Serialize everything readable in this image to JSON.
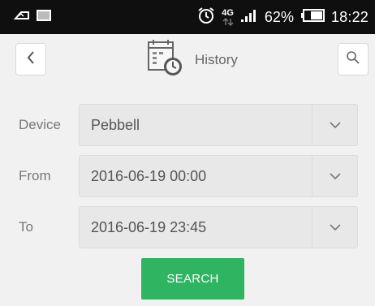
{
  "status_bar": {
    "network": "4G",
    "battery_percent": "62%",
    "time": "18:22"
  },
  "header": {
    "title": "History"
  },
  "form": {
    "device": {
      "label": "Device",
      "value": "Pebbell"
    },
    "from": {
      "label": "From",
      "value": "2016-06-19 00:00"
    },
    "to": {
      "label": "To",
      "value": "2016-06-19 23:45"
    }
  },
  "search_button": {
    "label": "SEARCH"
  },
  "colors": {
    "status_bar_bg": "#0f0f0f",
    "page_bg": "#f1f1f1",
    "field_bg": "#e8e8e8",
    "accent_green": "#2fb562"
  },
  "icons": {
    "back": "chevron-left-icon",
    "search": "magnifier-icon",
    "title": "calendar-clock-icon",
    "dropdown": "chevron-down-icon"
  }
}
